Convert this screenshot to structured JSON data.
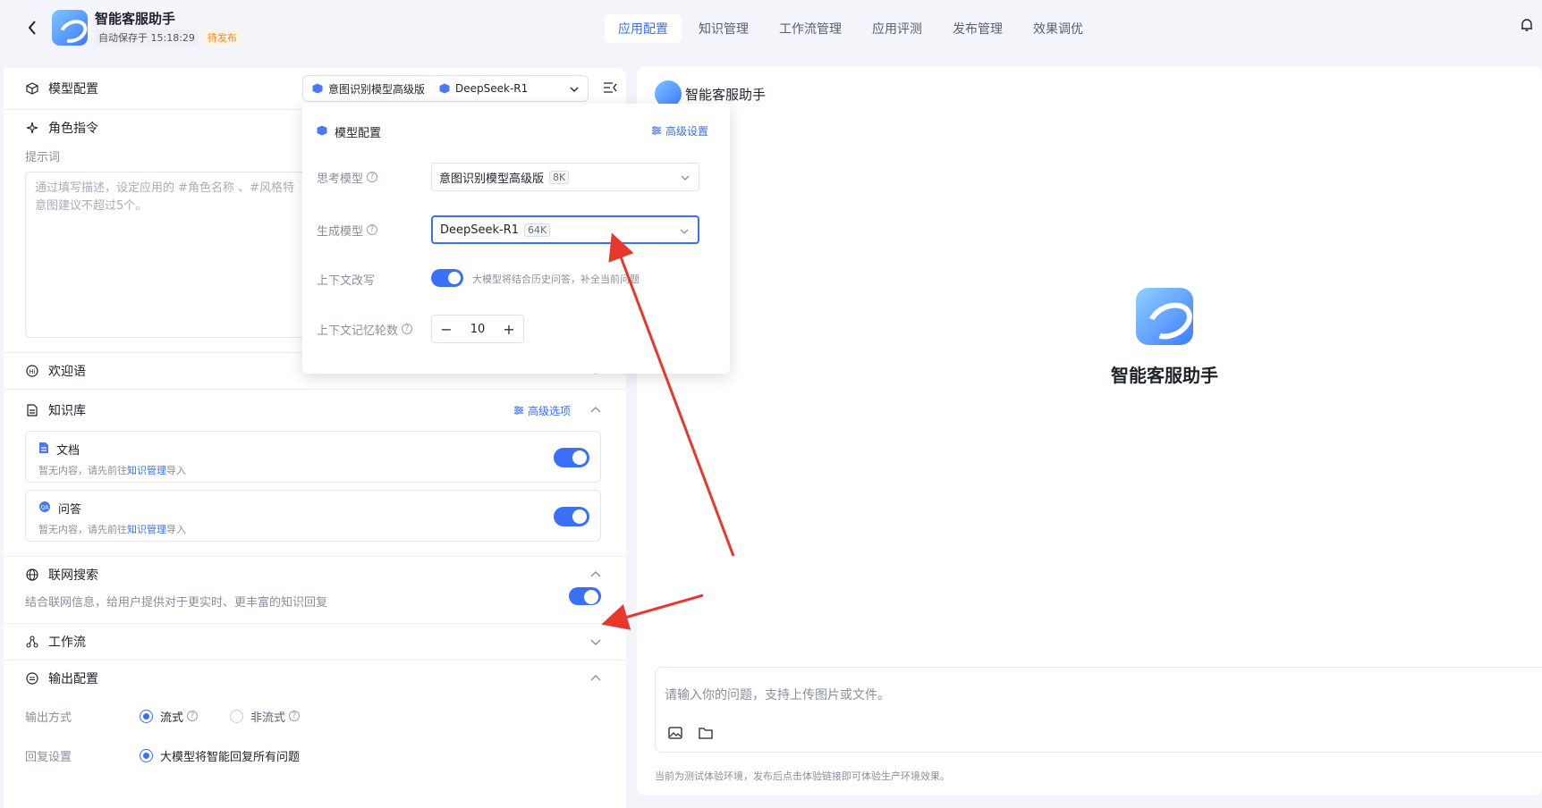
{
  "header": {
    "app_title": "智能客服助手",
    "autosave": "自动保存于 15:18:29",
    "status": "待发布",
    "tabs": [
      "应用配置",
      "知识管理",
      "工作流管理",
      "应用评测",
      "发布管理",
      "效果调优"
    ]
  },
  "left": {
    "model_config": {
      "label": "模型配置",
      "selected_think": "意图识别模型高级版",
      "selected_gen": "DeepSeek-R1"
    },
    "role": {
      "label": "角色指令",
      "prompt_label": "提示词",
      "prompt_placeholder_1": "通过填写描述，设定应用的 #角色名称 、#风格特",
      "prompt_placeholder_2": "意图建议不超过5个。"
    },
    "welcome": {
      "label": "欢迎语"
    },
    "knowledge": {
      "label": "知识库",
      "adv": "高级选项",
      "items": [
        {
          "title": "文档",
          "desc_pre": "暂无内容，请先前往",
          "desc_link": "知识管理",
          "desc_post": "导入"
        },
        {
          "title": "问答",
          "desc_pre": "暂无内容，请先前往",
          "desc_link": "知识管理",
          "desc_post": "导入"
        }
      ]
    },
    "web": {
      "label": "联网搜索",
      "desc": "结合联网信息，给用户提供对于更实时、更丰富的知识回复"
    },
    "workflow": {
      "label": "工作流"
    },
    "output": {
      "label": "输出配置",
      "mode_label": "输出方式",
      "mode_stream": "流式",
      "mode_nonstream": "非流式",
      "reply_label": "回复设置",
      "reply_opt": "大模型将智能回复所有问题"
    }
  },
  "popover": {
    "title": "模型配置",
    "adv": "高级设置",
    "think_label": "思考模型",
    "think_value": "意图识别模型高级版",
    "think_ctx": "8K",
    "gen_label": "生成模型",
    "gen_value": "DeepSeek-R1",
    "gen_ctx": "64K",
    "rewrite_label": "上下文改写",
    "rewrite_hint": "大模型将结合历史问答，补全当前问题",
    "memory_label": "上下文记忆轮数",
    "memory_value": "10"
  },
  "right": {
    "title": "智能客服助手",
    "center_name": "智能客服助手",
    "chat_placeholder": "请输入你的问题，支持上传图片或文件。",
    "env_note": "当前为测试体验环境，发布后点击体验链接即可体验生产环境效果。"
  },
  "colors": {
    "accent": "#3a6ff7",
    "arrow": "#e8382e",
    "pending": "#f08a24"
  }
}
